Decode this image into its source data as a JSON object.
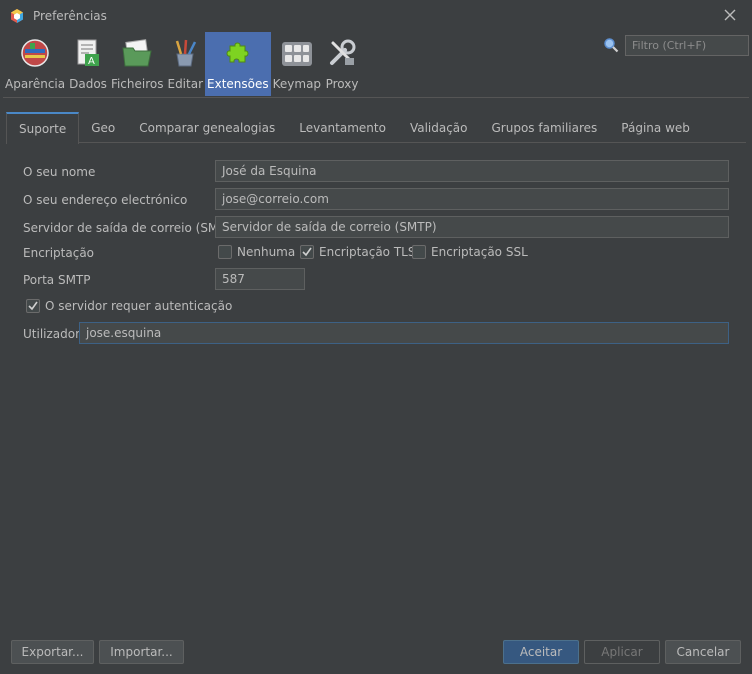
{
  "window": {
    "title": "Preferências",
    "close_icon": "close-icon"
  },
  "toolbar": {
    "items": [
      {
        "label": "Aparência",
        "icon": "globe-icon"
      },
      {
        "label": "Dados",
        "icon": "document-icon"
      },
      {
        "label": "Ficheiros",
        "icon": "folder-icon"
      },
      {
        "label": "Editar",
        "icon": "brushes-icon"
      },
      {
        "label": "Extensões",
        "icon": "puzzle-icon",
        "active": true
      },
      {
        "label": "Keymap",
        "icon": "keyboard-icon"
      },
      {
        "label": "Proxy",
        "icon": "wrench-icon"
      }
    ]
  },
  "filter": {
    "placeholder": "Filtro (Ctrl+F)"
  },
  "tabs": [
    {
      "label": "Suporte",
      "active": true
    },
    {
      "label": "Geo"
    },
    {
      "label": "Comparar genealogias"
    },
    {
      "label": "Levantamento"
    },
    {
      "label": "Validação"
    },
    {
      "label": "Grupos familiares"
    },
    {
      "label": "Página web"
    }
  ],
  "form": {
    "name_label": "O seu nome",
    "name_value": "José da Esquina",
    "email_label": "O seu endereço electrónico",
    "email_value": "jose@correio.com",
    "smtp_label": "Servidor de saída de correio (SMTP)",
    "smtp_value": "Servidor de saída de correio (SMTP)",
    "encryption_label": "Encriptação",
    "enc_none": {
      "label": "Nenhuma",
      "checked": false
    },
    "enc_tls": {
      "label": "Encriptação TLS",
      "checked": true
    },
    "enc_ssl": {
      "label": "Encriptação SSL",
      "checked": false
    },
    "port_label": "Porta SMTP",
    "port_value": "587",
    "auth": {
      "label": "O servidor requer autenticação",
      "checked": true
    },
    "user_label": "Utilizador",
    "user_value": "jose.esquina"
  },
  "buttons": {
    "export": "Exportar...",
    "import": "Importar...",
    "accept": "Aceitar",
    "apply": "Aplicar",
    "cancel": "Cancelar"
  },
  "colors": {
    "accent": "#4b6eaf",
    "background": "#3c3f41",
    "primary_button": "#365880"
  }
}
